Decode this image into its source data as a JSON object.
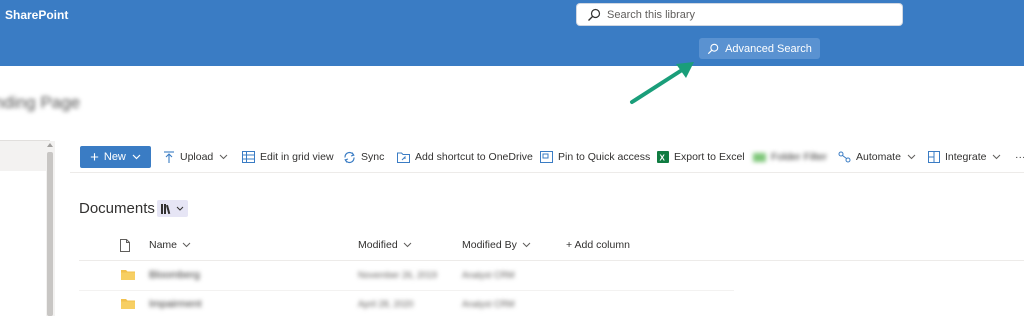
{
  "header": {
    "brand": "SharePoint",
    "search_placeholder": "Search this library",
    "advanced_search_label": "Advanced Search"
  },
  "site": {
    "title": "nding Page"
  },
  "commands": {
    "new_label": "New",
    "upload_label": "Upload",
    "edit_grid_label": "Edit in grid view",
    "sync_label": "Sync",
    "shortcut_label": "Add shortcut to OneDrive",
    "pin_label": "Pin to Quick access",
    "export_label": "Export to Excel",
    "folder_filter_label": "Folder Filter",
    "automate_label": "Automate",
    "integrate_label": "Integrate",
    "more_label": "···"
  },
  "library": {
    "title": "Documents",
    "columns": {
      "name": "Name",
      "modified": "Modified",
      "modified_by": "Modified By",
      "add_column": "+ Add column"
    },
    "rows": [
      {
        "name": "Bloomberg",
        "modified": "November 26, 2019",
        "modified_by": "Analyst CRM"
      },
      {
        "name": "Impairment",
        "modified": "April 28, 2020",
        "modified_by": "Analyst CRM"
      }
    ]
  },
  "colors": {
    "suite_bar": "#3a7cc4",
    "accent": "#3a7cc4",
    "annotation_arrow": "#1a9e7a",
    "folder": "#f2c14e"
  }
}
